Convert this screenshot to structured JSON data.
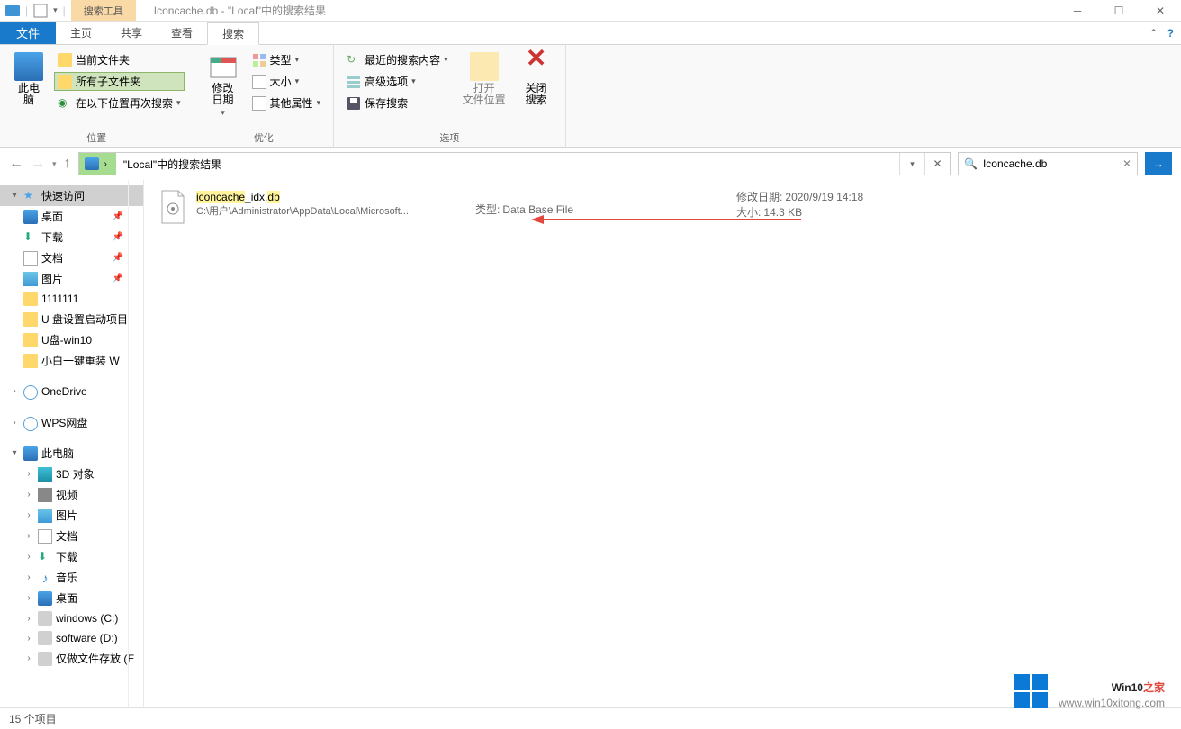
{
  "titlebar": {
    "contextual_tab": "搜索工具",
    "title": "Iconcache.db - \"Local\"中的搜索结果"
  },
  "tabs": {
    "file": "文件",
    "home": "主页",
    "share": "共享",
    "view": "查看",
    "search": "搜索"
  },
  "ribbon": {
    "group_location": {
      "this_pc": "此电\n脑",
      "current_folder": "当前文件夹",
      "all_subfolders": "所有子文件夹",
      "search_again": "在以下位置再次搜索",
      "label": "位置"
    },
    "group_optimize": {
      "modify_date": "修改\n日期",
      "type": "类型",
      "size": "大小",
      "other_props": "其他属性",
      "label": "优化"
    },
    "group_options": {
      "recent_searches": "最近的搜索内容",
      "advanced_options": "高级选项",
      "save_search": "保存搜索",
      "open_location": "打开\n文件位置",
      "close_search": "关闭\n搜索",
      "label": "选项"
    }
  },
  "nav": {
    "breadcrumb": "\"Local\"中的搜索结果",
    "search_value": "Iconcache.db"
  },
  "tree": {
    "quick_access": "快速访问",
    "desktop": "桌面",
    "downloads": "下载",
    "documents": "文档",
    "pictures": "图片",
    "f1": "1111111",
    "f2": "U 盘设置启动项目",
    "f3": "U盘-win10",
    "f4": "小白一键重装 W",
    "onedrive": "OneDrive",
    "wps": "WPS网盘",
    "this_pc": "此电脑",
    "objects3d": "3D 对象",
    "videos": "视频",
    "pictures2": "图片",
    "documents2": "文档",
    "downloads2": "下载",
    "music": "音乐",
    "desktop2": "桌面",
    "drive_c": "windows (C:)",
    "drive_d": "software (D:)",
    "drive_e": "仅做文件存放 (E"
  },
  "result": {
    "filename_pre": "iconcache",
    "filename_mid": "_idx.",
    "filename_post": "db",
    "path": "C:\\用户\\Administrator\\AppData\\Local\\Microsoft...",
    "type_label": "类型:",
    "type_value": "Data Base File",
    "date_label": "修改日期:",
    "date_value": "2020/9/19 14:18",
    "size_label": "大小:",
    "size_value": "14.3 KB"
  },
  "statusbar": {
    "items": "15 个项目"
  },
  "watermark": {
    "title_main": "Win10",
    "title_red": "之家",
    "url": "www.win10xitong.com"
  }
}
